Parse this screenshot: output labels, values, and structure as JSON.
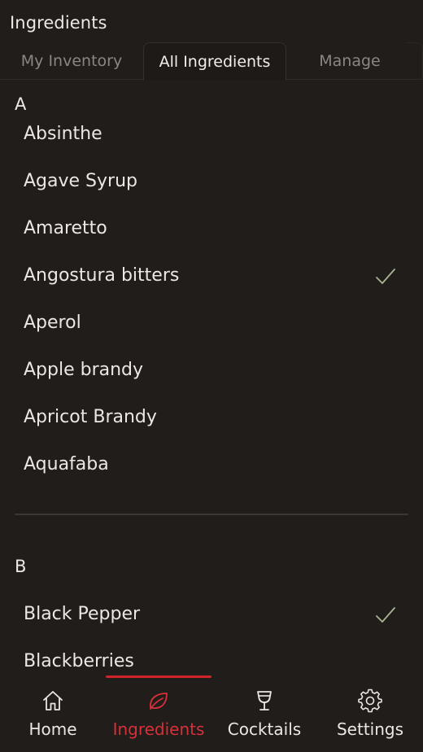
{
  "header": {
    "title": "Ingredients"
  },
  "tabs": [
    {
      "label": "My Inventory",
      "active": false
    },
    {
      "label": "All Ingredients",
      "active": true
    },
    {
      "label": "Manage",
      "active": false
    }
  ],
  "sections": [
    {
      "letter": "A",
      "items": [
        {
          "label": "Absinthe",
          "in_inventory": false
        },
        {
          "label": "Agave Syrup",
          "in_inventory": false
        },
        {
          "label": "Amaretto",
          "in_inventory": false
        },
        {
          "label": "Angostura bitters",
          "in_inventory": true
        },
        {
          "label": "Aperol",
          "in_inventory": false
        },
        {
          "label": "Apple brandy",
          "in_inventory": false
        },
        {
          "label": "Apricot Brandy",
          "in_inventory": false
        },
        {
          "label": "Aquafaba",
          "in_inventory": false
        }
      ]
    },
    {
      "letter": "B",
      "items": [
        {
          "label": "Black Pepper",
          "in_inventory": true
        },
        {
          "label": "Blackberries",
          "in_inventory": false
        }
      ]
    }
  ],
  "bottom_nav": [
    {
      "label": "Home",
      "icon": "home-icon",
      "active": false
    },
    {
      "label": "Ingredients",
      "icon": "leaf-icon",
      "active": true
    },
    {
      "label": "Cocktails",
      "icon": "cocktail-glass-icon",
      "active": false
    },
    {
      "label": "Settings",
      "icon": "gear-icon",
      "active": false
    }
  ],
  "colors": {
    "background": "#201d1b",
    "accent": "#d0232b",
    "check": "#a9b592",
    "text": "#ebe7e3",
    "muted_text": "#8a8682"
  }
}
